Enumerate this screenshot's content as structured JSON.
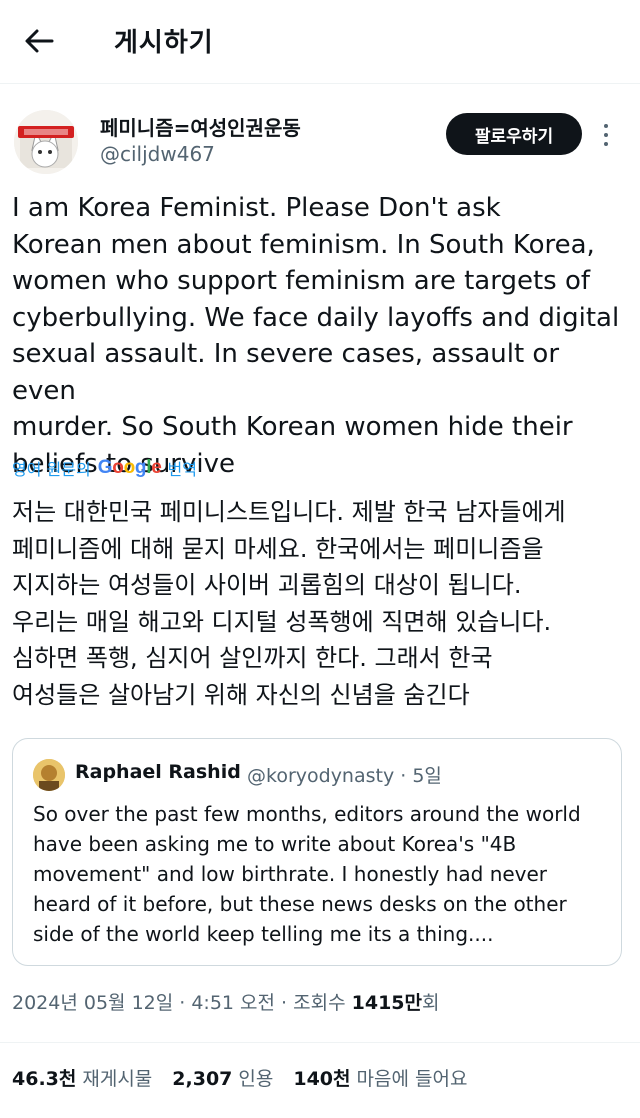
{
  "header": {
    "title": "게시하기",
    "back_icon": "arrow-left-icon"
  },
  "author": {
    "name": "페미니즘=여성인권운동",
    "handle": "@ciljdw467",
    "follow_label": "팔로우하기",
    "more_icon": "vertical-ellipsis-icon"
  },
  "tweet": {
    "text": "I am Korea Feminist. Please Don't ask\nKorean men about feminism. In South Korea,\nwomen who support feminism are targets of\ncyberbullying. We face daily layoffs and digital\nsexual assault. In severe cases, assault or even\nmurder. So South Korean women hide their\nbeliefs to survive",
    "translation_prefix": "영어 원문의",
    "translation_brand": "Google",
    "translation_suffix": "번역",
    "translated_text": "저는 대한민국 페미니스트입니다. 제발 한국 남자들에게\n페미니즘에 대해 묻지 마세요. 한국에서는 페미니즘을\n지지하는 여성들이 사이버 괴롭힘의 대상이 됩니다.\n우리는 매일 해고와 디지털 성폭행에 직면해 있습니다.\n심하면 폭행, 심지어 살인까지 한다. 그래서 한국\n여성들은 살아남기 위해 자신의 신념을 숨긴다"
  },
  "quote": {
    "name": "Raphael Rashid",
    "handle_time": "@koryodynasty · 5일",
    "text": "So over the past few months, editors around the world\nhave been asking me to write about Korea's \"4B\nmovement\" and low birthrate. I honestly had never\nheard of it before, but these news desks on the other\nside of the world keep telling me its a thing...."
  },
  "meta": {
    "datetime": "2024년 05월 12일 · 4:51 오전 · 조회수 ",
    "views_value": "1415만",
    "views_suffix": "회"
  },
  "stats": [
    {
      "value": "46.3천",
      "label": "재게시물"
    },
    {
      "value": "2,307",
      "label": "인용"
    },
    {
      "value": "140천",
      "label": "마음에 들어요"
    }
  ],
  "colors": {
    "text": "#0f1419",
    "secondary": "#536471",
    "link": "#1d9bf0",
    "border": "#cfd9de"
  }
}
